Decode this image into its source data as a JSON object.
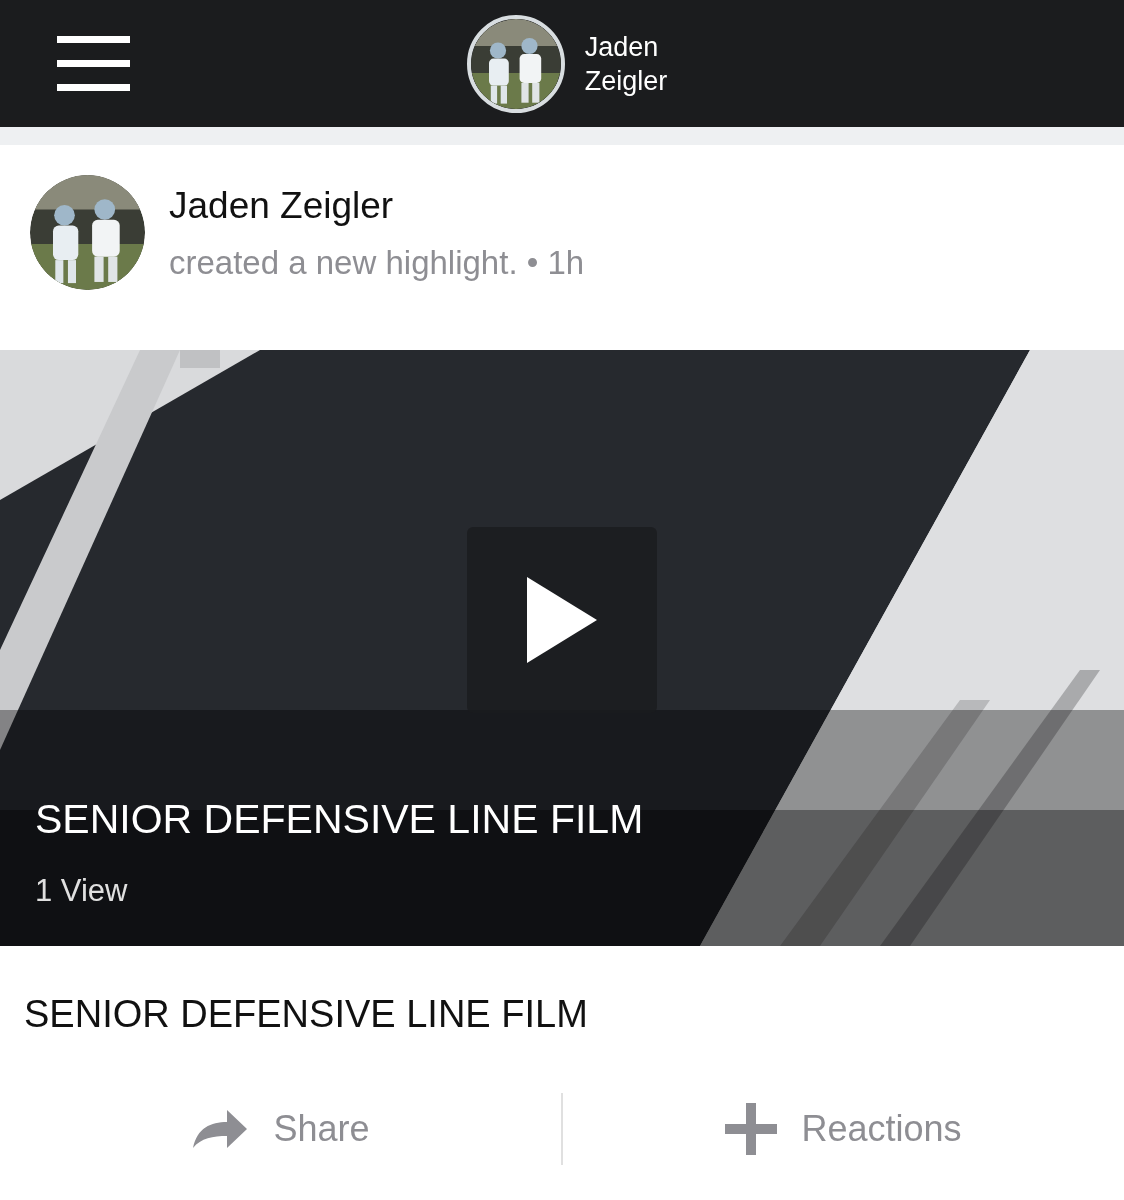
{
  "header": {
    "user_name": "Jaden\nZeigler"
  },
  "post": {
    "author": "Jaden Zeigler",
    "activity": "created a new highlight.",
    "separator": "•",
    "time": "1h",
    "video": {
      "title": "SENIOR DEFENSIVE LINE FILM",
      "views": "1 View"
    },
    "caption": "SENIOR DEFENSIVE LINE FILM",
    "actions": [
      {
        "kind": "share",
        "label": "Share"
      },
      {
        "kind": "reactions",
        "label": "Reactions"
      }
    ]
  }
}
